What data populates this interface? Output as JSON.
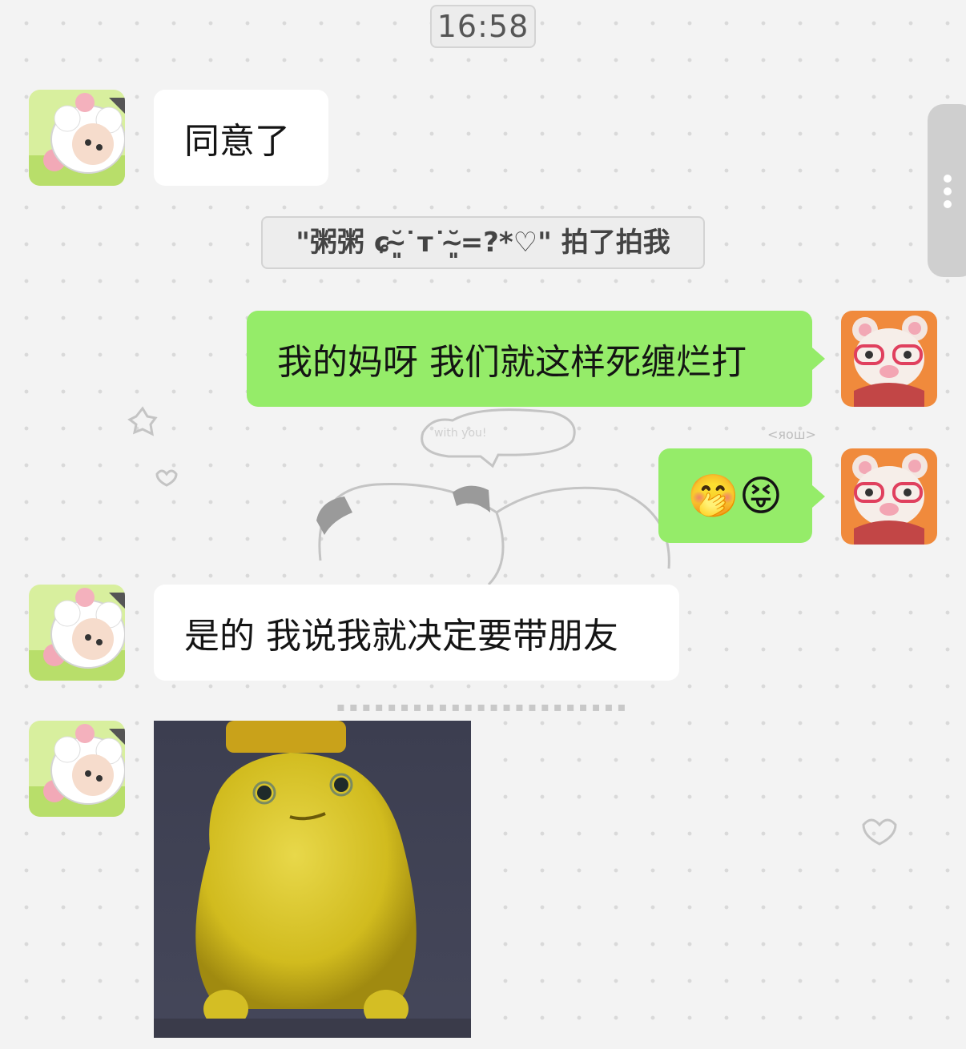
{
  "timestamp": "16:58",
  "pat_notice": "\"粥粥 ɕ˘̴͈˙ᴛ˙˘̴͈=?*♡\" 拍了拍我",
  "messages": [
    {
      "side": "left",
      "text": "同意了"
    },
    {
      "side": "right",
      "text": "我的妈呀 我们就这样死缠烂打"
    },
    {
      "side": "right",
      "text": "🤭😝"
    },
    {
      "side": "left",
      "text": "是的 我说我就决定要带朋友"
    },
    {
      "side": "left",
      "type": "image",
      "image_desc": "yellow-blob-toy-sticker"
    }
  ],
  "avatars": {
    "contact": "sheep-avatar",
    "self": "pink-bear-avatar"
  },
  "colors": {
    "outgoing_bubble": "#95ec69",
    "incoming_bubble": "#ffffff",
    "background": "#f3f3f3"
  }
}
